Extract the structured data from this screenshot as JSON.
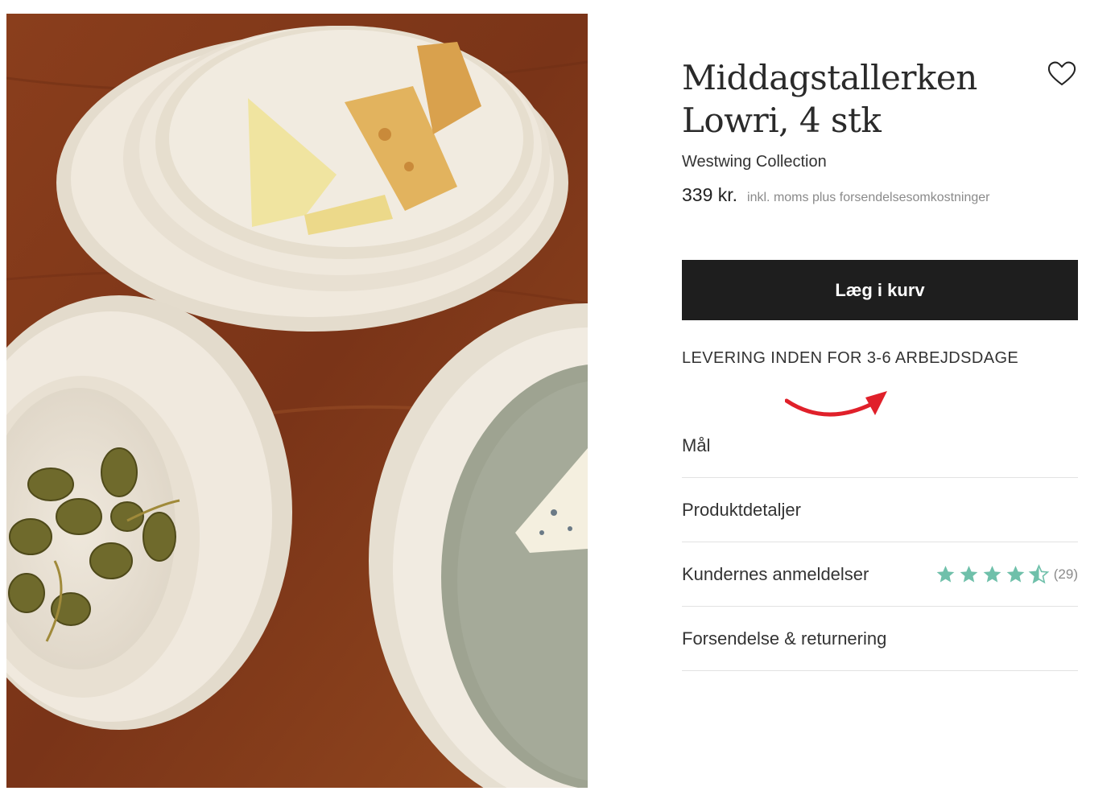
{
  "product": {
    "title_line1": "Middagstallerken",
    "title_line2": "Lowri, 4 stk",
    "brand": "Westwing Collection",
    "price": "339 kr.",
    "price_note": "inkl. moms plus forsendelsesomkostninger",
    "image_alt": "Middagstallerken Lowri"
  },
  "actions": {
    "add_to_cart": "Læg i kurv",
    "wishlist_icon": "heart-icon"
  },
  "delivery": {
    "text": "LEVERING INDEN FOR 3-6 ARBEJDSDAGE",
    "annotation_icon": "red-curved-arrow-icon"
  },
  "sections": [
    {
      "label": "Mål"
    },
    {
      "label": "Produktdetaljer"
    },
    {
      "label": "Kundernes anmeldelser"
    },
    {
      "label": "Forsendelse & returnering"
    }
  ],
  "reviews": {
    "rating": 4.5,
    "max": 5,
    "count": "(29)",
    "star_color": "#6fc0aa"
  },
  "colors": {
    "button_bg": "#1e1e1e",
    "arrow": "#e0202a"
  }
}
